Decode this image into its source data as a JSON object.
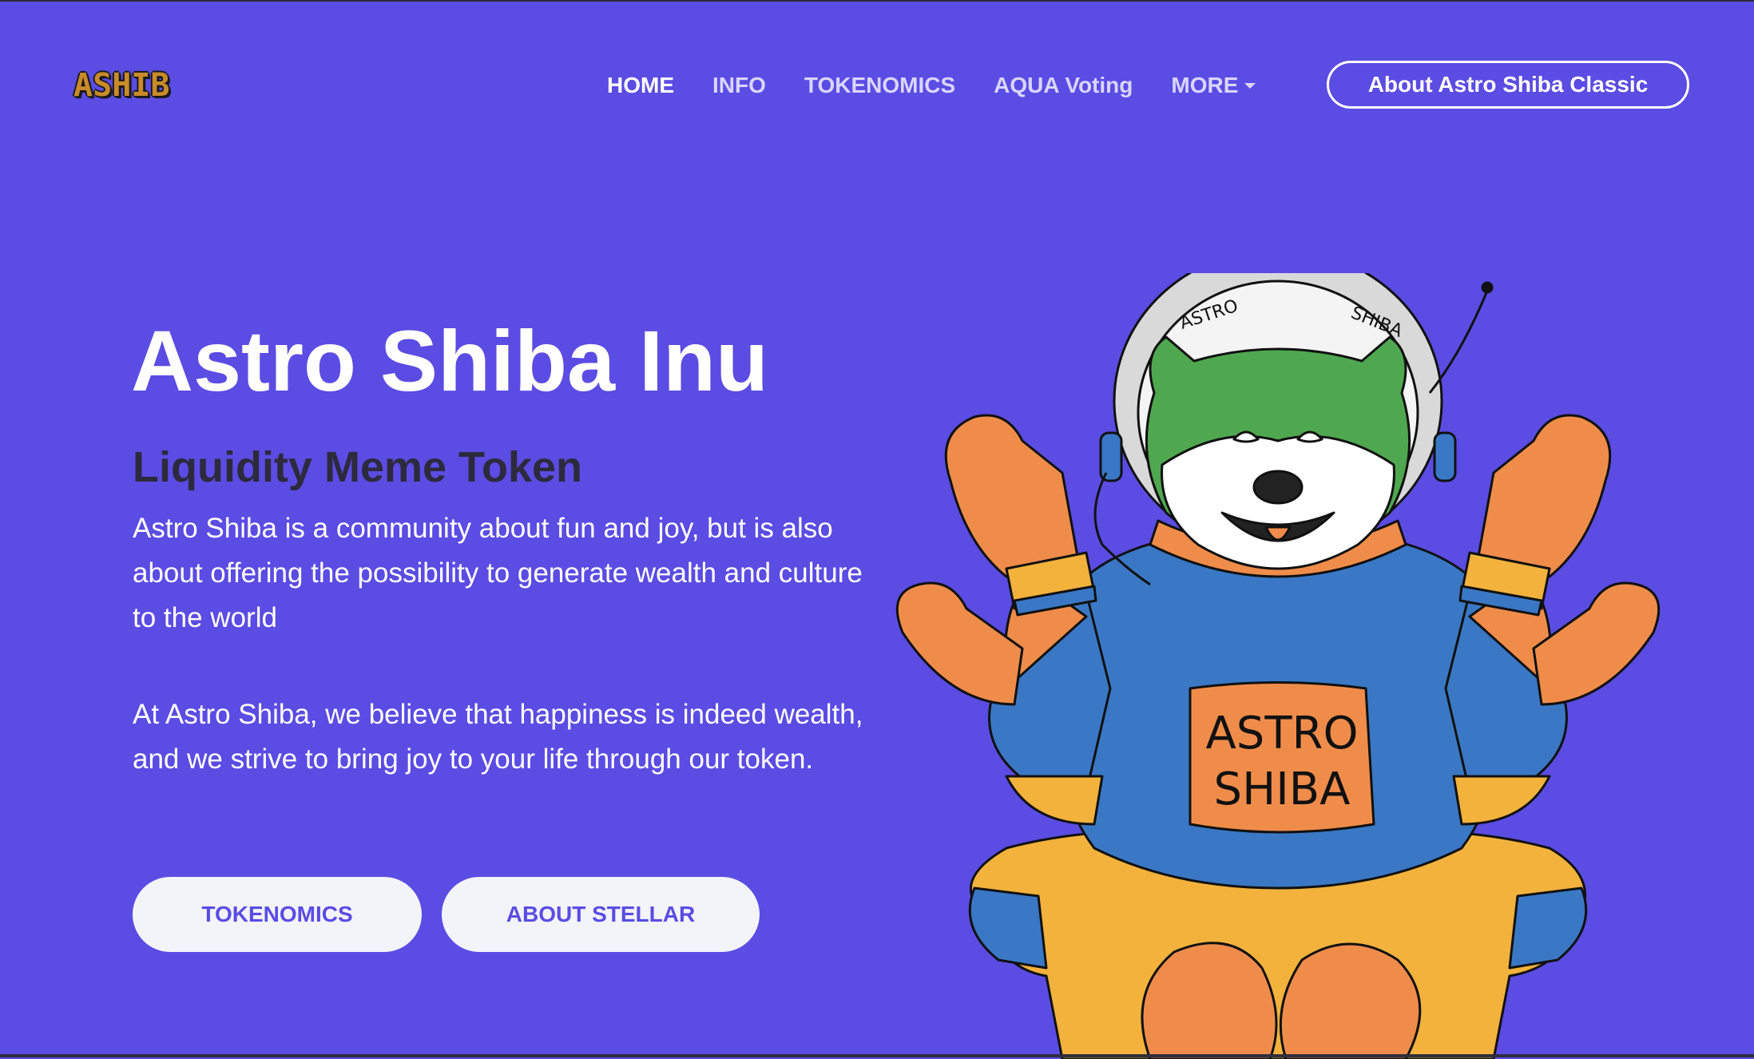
{
  "brand": {
    "logo_letters": [
      "A",
      "S",
      "H",
      "I",
      "B"
    ]
  },
  "nav": {
    "items": [
      {
        "label": "HOME",
        "active": true
      },
      {
        "label": "INFO"
      },
      {
        "label": "TOKENOMICS"
      },
      {
        "label": "AQUA Voting"
      },
      {
        "label": "MORE",
        "has_dropdown": true
      }
    ],
    "cta_label": "About Astro Shiba Classic"
  },
  "hero": {
    "title": "Astro Shiba Inu",
    "subtitle": "Liquidity Meme Token",
    "paragraph_1": "Astro Shiba is a community about fun and joy, but is also about offering the possibility to generate wealth and culture to the world",
    "paragraph_2": "At Astro Shiba, we believe that happiness is indeed wealth, and we strive to bring joy to your life through our token.",
    "buttons": [
      {
        "label": "TOKENOMICS"
      },
      {
        "label": "ABOUT STELLAR"
      }
    ]
  },
  "illustration": {
    "helmet_text_left": "ASTRO",
    "helmet_text_right": "SHIBA",
    "shirt_line_1": "ASTRO",
    "shirt_line_2": "SHIBA"
  },
  "colors": {
    "background": "#5b4ce3",
    "subtitle": "#2d2a3e",
    "pill_bg": "#f2f4fa",
    "suit_blue": "#3a78c6",
    "suit_orange": "#f08c4a",
    "suit_yellow": "#f2b23c",
    "shiba_green": "#4fa84f"
  }
}
